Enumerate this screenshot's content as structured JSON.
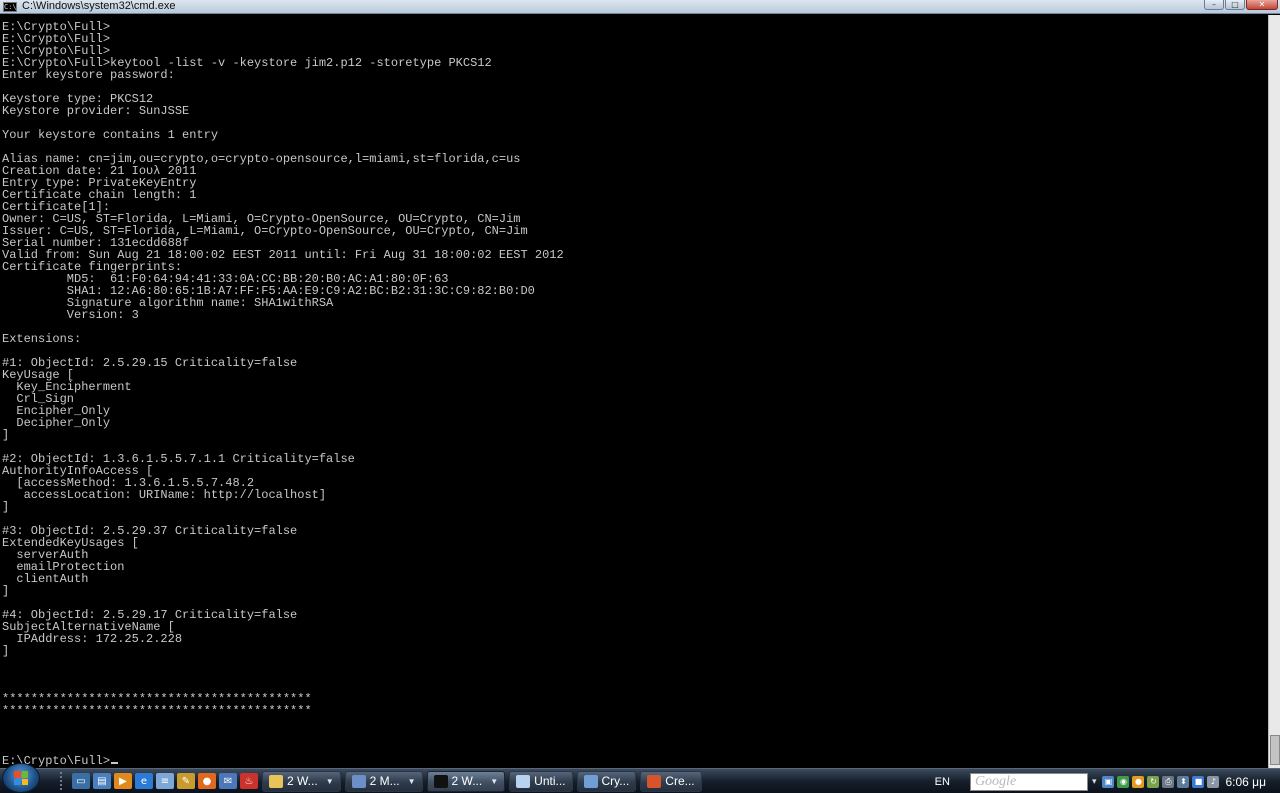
{
  "window": {
    "title": "C:\\Windows\\system32\\cmd.exe",
    "icon": "cmd-icon",
    "icon_text": "C:\\",
    "buttons": {
      "minimize": "–",
      "maximize": "□",
      "close": "✕"
    }
  },
  "console": {
    "lines": [
      "E:\\Crypto\\Full>",
      "E:\\Crypto\\Full>",
      "E:\\Crypto\\Full>",
      "E:\\Crypto\\Full>keytool -list -v -keystore jim2.p12 -storetype PKCS12",
      "Enter keystore password:",
      "",
      "Keystore type: PKCS12",
      "Keystore provider: SunJSSE",
      "",
      "Your keystore contains 1 entry",
      "",
      "Alias name: cn=jim,ou=crypto,o=crypto-opensource,l=miami,st=florida,c=us",
      "Creation date: 21 Ιουλ 2011",
      "Entry type: PrivateKeyEntry",
      "Certificate chain length: 1",
      "Certificate[1]:",
      "Owner: C=US, ST=Florida, L=Miami, O=Crypto-OpenSource, OU=Crypto, CN=Jim",
      "Issuer: C=US, ST=Florida, L=Miami, O=Crypto-OpenSource, OU=Crypto, CN=Jim",
      "Serial number: 131ecdd688f",
      "Valid from: Sun Aug 21 18:00:02 EEST 2011 until: Fri Aug 31 18:00:02 EEST 2012",
      "Certificate fingerprints:",
      "         MD5:  61:F0:64:94:41:33:0A:CC:BB:20:B0:AC:A1:80:0F:63",
      "         SHA1: 12:A6:80:65:1B:A7:FF:F5:AA:E9:C9:A2:BC:B2:31:3C:C9:82:B0:D0",
      "         Signature algorithm name: SHA1withRSA",
      "         Version: 3",
      "",
      "Extensions:",
      "",
      "#1: ObjectId: 2.5.29.15 Criticality=false",
      "KeyUsage [",
      "  Key_Encipherment",
      "  Crl_Sign",
      "  Encipher_Only",
      "  Decipher_Only",
      "]",
      "",
      "#2: ObjectId: 1.3.6.1.5.5.7.1.1 Criticality=false",
      "AuthorityInfoAccess [",
      "  [accessMethod: 1.3.6.1.5.5.7.48.2",
      "   accessLocation: URIName: http://localhost]",
      "]",
      "",
      "#3: ObjectId: 2.5.29.37 Criticality=false",
      "ExtendedKeyUsages [",
      "  serverAuth",
      "  emailProtection",
      "  clientAuth",
      "]",
      "",
      "#4: ObjectId: 2.5.29.17 Criticality=false",
      "SubjectAlternativeName [",
      "  IPAddress: 172.25.2.228",
      "]",
      "",
      "",
      "",
      "*******************************************",
      "*******************************************"
    ],
    "prompt": "E:\\Crypto\\Full>"
  },
  "taskbar": {
    "quick_launch": [
      {
        "icon": "show-desktop-icon",
        "glyph": "▭",
        "color": "#3a6ea5"
      },
      {
        "icon": "switch-windows-icon",
        "glyph": "▤",
        "color": "#4a7fc0"
      },
      {
        "icon": "media-player-icon",
        "glyph": "▶",
        "color": "#e08a1e"
      },
      {
        "icon": "internet-explorer-icon",
        "glyph": "e",
        "color": "#2b7bd6"
      },
      {
        "icon": "notepad-icon",
        "glyph": "≡",
        "color": "#7da7d8"
      },
      {
        "icon": "paint-icon",
        "glyph": "✎",
        "color": "#c99a2e"
      },
      {
        "icon": "firefox-icon",
        "glyph": "●",
        "color": "#e2681f"
      },
      {
        "icon": "outlook-icon",
        "glyph": "✉",
        "color": "#4d77b8"
      },
      {
        "icon": "java-icon",
        "glyph": "♨",
        "color": "#c9332b"
      }
    ],
    "tasks": [
      {
        "label": "2 W...",
        "icon": "folder-icon",
        "color": "#e8c35a",
        "has_arrow": true,
        "active": false
      },
      {
        "label": "2 M...",
        "icon": "editor-icon",
        "color": "#6d8fc7",
        "has_arrow": true,
        "active": false
      },
      {
        "label": "2 W...",
        "icon": "cmd-icon",
        "color": "#111111",
        "has_arrow": true,
        "active": true
      },
      {
        "label": "Unti...",
        "icon": "notepad-icon",
        "color": "#b8d3ef",
        "has_arrow": false,
        "active": false
      },
      {
        "label": "Cry...",
        "icon": "keychain-icon",
        "color": "#6f9fd4",
        "has_arrow": false,
        "active": false
      },
      {
        "label": "Cre...",
        "icon": "java-icon",
        "color": "#d6532c",
        "has_arrow": false,
        "active": false
      }
    ],
    "language": "EN",
    "search_placeholder": "Google",
    "tray_expand": "▾",
    "tray_icons": [
      {
        "icon": "network-icon",
        "glyph": "▣",
        "color": "#4f86c8"
      },
      {
        "icon": "antivirus-icon",
        "glyph": "◉",
        "color": "#3f9b4a"
      },
      {
        "icon": "update-icon",
        "glyph": "●",
        "color": "#e39b20"
      },
      {
        "icon": "sync-icon",
        "glyph": "↻",
        "color": "#7aa24b"
      },
      {
        "icon": "printer-icon",
        "glyph": "⎙",
        "color": "#6a7886"
      },
      {
        "icon": "safely-remove-icon",
        "glyph": "⬍",
        "color": "#5f7b9c"
      },
      {
        "icon": "display-icon",
        "glyph": "■",
        "color": "#3c7bd0"
      },
      {
        "icon": "volume-icon",
        "glyph": "♪",
        "color": "#8a96a6"
      }
    ],
    "clock": "6:06 μμ"
  }
}
